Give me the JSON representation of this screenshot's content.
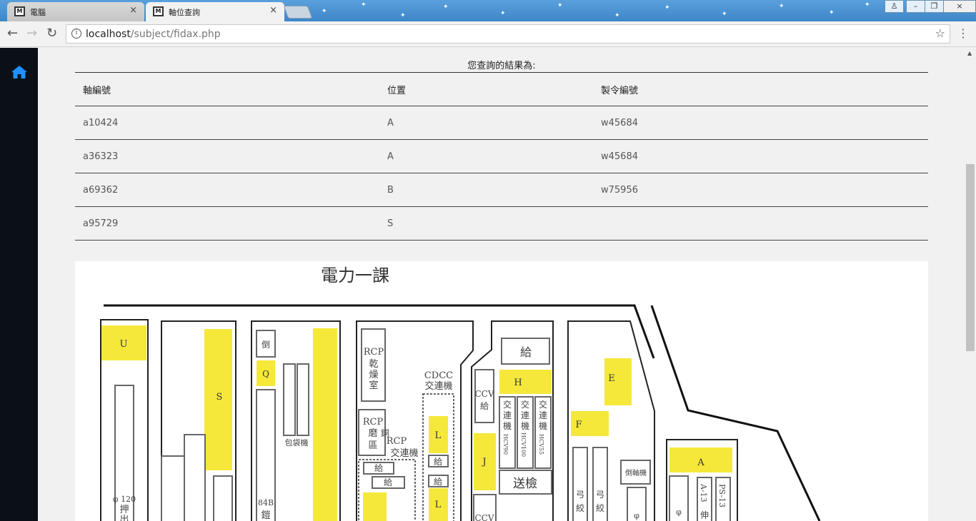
{
  "browser": {
    "tabs": [
      {
        "label": "電腦",
        "favicon": "M"
      },
      {
        "label": "軸位查詢",
        "favicon": "M"
      }
    ],
    "url_host": "localhost",
    "url_path": "/subject/fidax.php",
    "icons": [
      "back-icon",
      "forward-icon",
      "reload-icon",
      "info-icon",
      "bookmark-star-icon",
      "menu-icon",
      "close-icon",
      "minimize-icon",
      "maximize-icon",
      "user-icon"
    ]
  },
  "sidebar": {
    "icon": "home-icon",
    "accent": "#1e90ff",
    "background": "#0b1016"
  },
  "result": {
    "title": "您查詢的結果為:",
    "headers": [
      "軸編號",
      "位置",
      "製令編號"
    ],
    "rows": [
      [
        "a10424",
        "A",
        "w45684"
      ],
      [
        "a36323",
        "A",
        "w45684"
      ],
      [
        "a69362",
        "B",
        "w75956"
      ],
      [
        "a95729",
        "S",
        ""
      ]
    ]
  },
  "map": {
    "title": "電力一課",
    "highlight_color": "#f5e83a",
    "zones": [
      "U",
      "S",
      "Q",
      "E",
      "H",
      "F",
      "L",
      "J",
      "A"
    ],
    "labels": {
      "dao": "倒",
      "baodaiji": "包袋機",
      "b84": "84B",
      "kai": "鎧",
      "rcp": "RCP",
      "gan": "乾",
      "zao": "燥",
      "shi": "室",
      "mo": "磨",
      "tong": "銅",
      "qu": "區",
      "rcp_cross": "交連機",
      "cdcc": "CDCC",
      "cdcc_cross": "交連機",
      "gei": "給",
      "ccv": "CCV",
      "jiao": "交",
      "lian": "連",
      "ji": "機",
      "hcv90": "HCV90",
      "hcv100": "HCV100",
      "hcv55": "HCV55",
      "songjian": "送檢",
      "gong": "弓",
      "jiao2": "絞",
      "daozhouji": "倒軸機",
      "a13": "A-13",
      "shen": "伸",
      "ps13": "PS-13",
      "phi120": "φ 120",
      "ya": "押",
      "chu": "出",
      "phi": "φ"
    }
  }
}
